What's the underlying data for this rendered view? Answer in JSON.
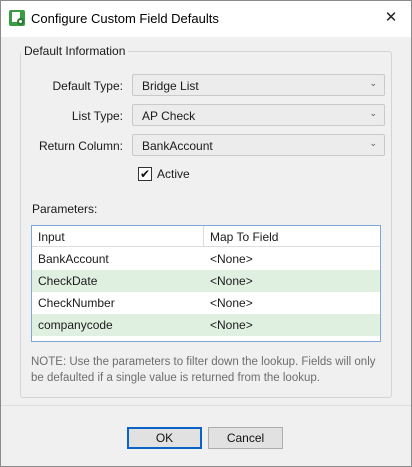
{
  "window": {
    "title": "Configure Custom Field Defaults",
    "close_glyph": "✕",
    "app_icon": "custom-field-icon"
  },
  "group": {
    "legend": "Default Information"
  },
  "fields": {
    "default_type": {
      "label": "Default Type:",
      "value": "Bridge List"
    },
    "list_type": {
      "label": "List Type:",
      "value": "AP Check"
    },
    "return_column": {
      "label": "Return Column:",
      "value": "BankAccount"
    }
  },
  "active": {
    "label": "Active",
    "checked": true,
    "check_glyph": "✔"
  },
  "parameters": {
    "label": "Parameters:",
    "columns": [
      "Input",
      "Map To Field"
    ],
    "rows": [
      {
        "input": "BankAccount",
        "map": "<None>"
      },
      {
        "input": "CheckDate",
        "map": "<None>"
      },
      {
        "input": "CheckNumber",
        "map": "<None>"
      },
      {
        "input": "companycode",
        "map": "<None>"
      }
    ],
    "row_alt_color": "#e0f0e0"
  },
  "note": "NOTE: Use the parameters to filter down the lookup. Fields will only be defaulted if a single value is returned from the lookup.",
  "buttons": {
    "ok": "OK",
    "cancel": "Cancel"
  },
  "dropdown_glyph": "⌄"
}
